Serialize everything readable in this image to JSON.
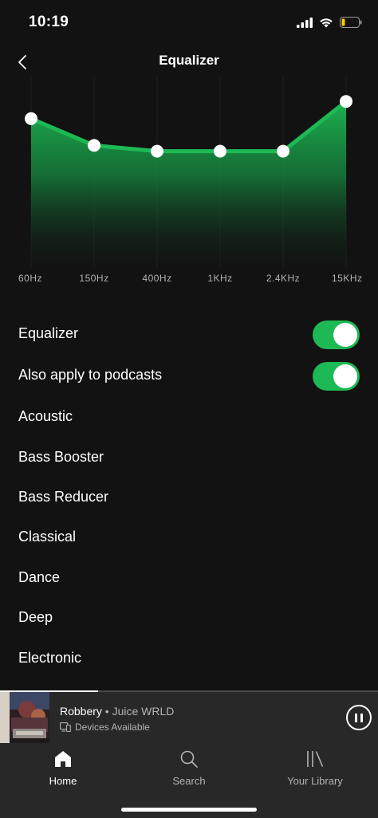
{
  "status_bar": {
    "time": "10:19",
    "icons": [
      "cellular-signal-icon",
      "wifi-icon",
      "battery-low-icon"
    ]
  },
  "header": {
    "title": "Equalizer",
    "back_icon": "chevron-left-icon"
  },
  "equalizer": {
    "bands": [
      {
        "label": "60Hz",
        "level": 0.78
      },
      {
        "label": "150Hz",
        "level": 0.64
      },
      {
        "label": "400Hz",
        "level": 0.61
      },
      {
        "label": "1KHz",
        "level": 0.61
      },
      {
        "label": "2.4KHz",
        "level": 0.61
      },
      {
        "label": "15KHz",
        "level": 0.87
      }
    ],
    "accent_color": "#1db954"
  },
  "settings": {
    "equalizer_toggle": {
      "label": "Equalizer",
      "on": true
    },
    "podcasts_toggle": {
      "label": "Also apply to podcasts",
      "on": true
    }
  },
  "presets": [
    "Acoustic",
    "Bass Booster",
    "Bass Reducer",
    "Classical",
    "Dance",
    "Deep",
    "Electronic"
  ],
  "now_playing": {
    "title": "Robbery",
    "separator": " • ",
    "artist": "Juice WRLD",
    "devices_label": "Devices Available",
    "progress": 0.26,
    "pause_icon": "pause-icon"
  },
  "tab_bar": {
    "tabs": [
      {
        "label": "Home",
        "icon": "home-icon",
        "active": true
      },
      {
        "label": "Search",
        "icon": "search-icon",
        "active": false
      },
      {
        "label": "Your Library",
        "icon": "library-icon",
        "active": false
      }
    ]
  }
}
